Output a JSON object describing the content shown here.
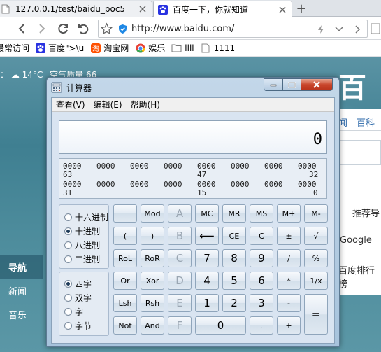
{
  "browser": {
    "tabs": [
      {
        "title": "127.0.0.1/test/baidu_poc5",
        "icon": "page-icon",
        "active": false
      },
      {
        "title": "百度一下，你就知道",
        "icon": "baidu-paw-icon",
        "active": true
      }
    ],
    "address": {
      "url": "http://www.baidu.com/"
    },
    "bookmarks": [
      {
        "label": "最常访问",
        "icon": "none"
      },
      {
        "label": "百度\">\\u",
        "icon": "baidu-paw-icon"
      },
      {
        "label": "淘宝网",
        "icon": "taobao-icon"
      },
      {
        "label": "娱乐",
        "icon": "chrome-icon"
      },
      {
        "label": "llll",
        "icon": "folder-icon"
      },
      {
        "label": "1111",
        "icon": "page-icon"
      }
    ]
  },
  "page": {
    "weather": {
      "location_suffix": "：",
      "temp": "14°C",
      "air": "空气质量 66"
    },
    "logo_fragment": "百度",
    "tabs_fragment": "闻　百科",
    "recommend": "推荐导",
    "google": "Google",
    "rank": "百度排行榜",
    "left_nav": [
      "导航",
      "新闻",
      "音乐"
    ]
  },
  "calculator": {
    "title": "计算器",
    "menu": [
      "查看(V)",
      "编辑(E)",
      "帮助(H)"
    ],
    "display": "0",
    "bits": {
      "row1": [
        "0000",
        "0000",
        "0000",
        "0000",
        "0000",
        "0000",
        "0000",
        "0000"
      ],
      "row1_labels": [
        "63",
        "47",
        "32"
      ],
      "row2": [
        "0000",
        "0000",
        "0000",
        "0000",
        "0000",
        "0000",
        "0000",
        "0000"
      ],
      "row2_labels": [
        "31",
        "15",
        "0"
      ]
    },
    "base_options": [
      "十六进制",
      "十进制",
      "八进制",
      "二进制"
    ],
    "base_selected": "十进制",
    "word_options": [
      "四字",
      "双字",
      "字",
      "字节"
    ],
    "word_selected": "四字",
    "keys": {
      "mod": "Mod",
      "a": "A",
      "mc": "MC",
      "mr": "MR",
      "ms": "MS",
      "mplus": "M+",
      "mminus": "M-",
      "lparen": "(",
      "rparen": ")",
      "b": "B",
      "back": "⟵",
      "ce": "CE",
      "c": "C",
      "plusminus": "±",
      "sqrt": "√",
      "rol": "RoL",
      "ror": "RoR",
      "ckey": "C",
      "n7": "7",
      "n8": "8",
      "n9": "9",
      "div": "/",
      "pct": "%",
      "or": "Or",
      "xor": "Xor",
      "d": "D",
      "n4": "4",
      "n5": "5",
      "n6": "6",
      "mul": "*",
      "recip": "1/x",
      "lsh": "Lsh",
      "rsh": "Rsh",
      "e": "E",
      "n1": "1",
      "n2": "2",
      "n3": "3",
      "sub": "-",
      "eq": "=",
      "not": "Not",
      "and": "And",
      "f": "F",
      "n0": "0",
      "dot": ".",
      "add": "+"
    }
  },
  "colors": {
    "accent": "#1f3c5a",
    "close_button": "#c9462c",
    "page_bg": "#3f7f91"
  }
}
